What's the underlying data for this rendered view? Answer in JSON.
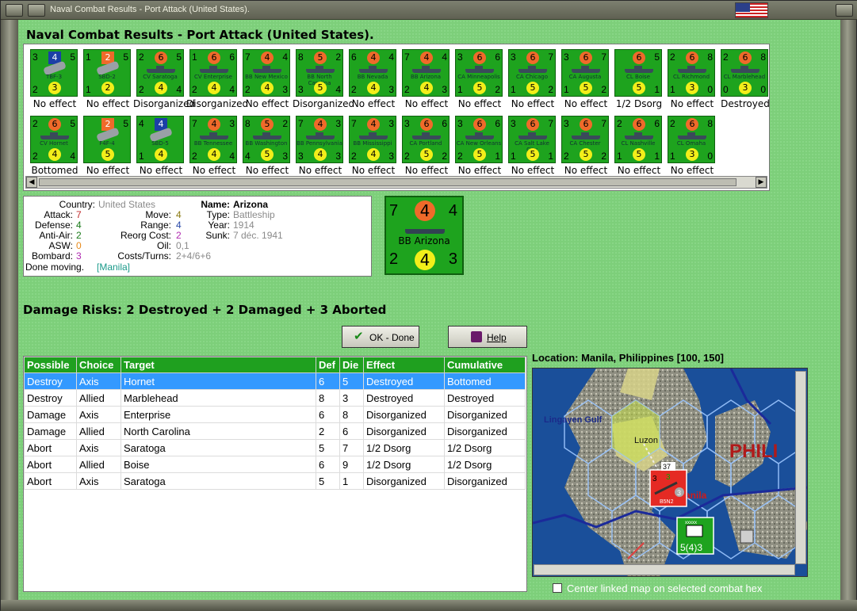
{
  "window": {
    "title": "Naval Combat Results - Port Attack (United States)."
  },
  "heading": "Naval Combat Results - Port Attack (United States).",
  "colors": {
    "felt": "#7dcf7a",
    "counter": "#1ea31e",
    "attack_circle": "#ef6a2a",
    "defense_circle": "#f2ee1a",
    "header": "#1fa01f",
    "selection": "#3399ff"
  },
  "units": [
    {
      "tl": "3",
      "top": "4",
      "top_style": "sq",
      "tr": "5",
      "bl": "2",
      "bot": "3",
      "br": "",
      "name": "TBF-3",
      "kind": "plane",
      "effect": "No effect"
    },
    {
      "tl": "1",
      "top": "2",
      "top_style": "sqo",
      "tr": "5",
      "bl": "1",
      "bot": "2",
      "br": "",
      "name": "SBD-2",
      "kind": "plane",
      "effect": "No effect"
    },
    {
      "tl": "2",
      "top": "6",
      "top_style": "",
      "tr": "5",
      "bl": "2",
      "bot": "4",
      "br": "4",
      "name": "CV Saratoga",
      "kind": "ship",
      "effect": "Disorganized"
    },
    {
      "tl": "1",
      "top": "6",
      "top_style": "",
      "tr": "6",
      "bl": "2",
      "bot": "4",
      "br": "4",
      "name": "CV Enterprise",
      "kind": "ship",
      "effect": "Disorganized"
    },
    {
      "tl": "7",
      "top": "4",
      "top_style": "",
      "tr": "4",
      "bl": "2",
      "bot": "4",
      "br": "3",
      "name": "BB New Mexico",
      "kind": "ship",
      "effect": "No effect"
    },
    {
      "tl": "8",
      "top": "5",
      "top_style": "",
      "tr": "2",
      "bl": "3",
      "bot": "5",
      "br": "4",
      "name": "BB North Carolina",
      "kind": "ship",
      "effect": "Disorganized"
    },
    {
      "tl": "6",
      "top": "4",
      "top_style": "",
      "tr": "4",
      "bl": "2",
      "bot": "4",
      "br": "3",
      "name": "BB Nevada",
      "kind": "ship",
      "effect": "No effect"
    },
    {
      "tl": "7",
      "top": "4",
      "top_style": "",
      "tr": "4",
      "bl": "2",
      "bot": "4",
      "br": "3",
      "name": "BB Arizona",
      "kind": "ship",
      "effect": "No effect"
    },
    {
      "tl": "3",
      "top": "6",
      "top_style": "",
      "tr": "6",
      "bl": "1",
      "bot": "5",
      "br": "2",
      "name": "CA Minneapolis",
      "kind": "ship",
      "effect": "No effect"
    },
    {
      "tl": "3",
      "top": "6",
      "top_style": "",
      "tr": "7",
      "bl": "1",
      "bot": "5",
      "br": "2",
      "name": "CA Chicago",
      "kind": "ship",
      "effect": "No effect"
    },
    {
      "tl": "3",
      "top": "6",
      "top_style": "",
      "tr": "7",
      "bl": "1",
      "bot": "5",
      "br": "2",
      "name": "CA Augusta",
      "kind": "ship",
      "effect": "No effect"
    },
    {
      "tl": "",
      "top": "6",
      "top_style": "",
      "tr": "5",
      "bl": "",
      "bot": "5",
      "br": "1",
      "name": "CL Boise",
      "kind": "ship",
      "effect": "1/2 Dsorg"
    },
    {
      "tl": "2",
      "top": "6",
      "top_style": "",
      "tr": "8",
      "bl": "1",
      "bot": "3",
      "br": "0",
      "name": "CL Richmond",
      "kind": "ship",
      "effect": "No effect"
    },
    {
      "tl": "2",
      "top": "6",
      "top_style": "",
      "tr": "8",
      "bl": "0",
      "bot": "3",
      "br": "0",
      "name": "CL Marblehead",
      "kind": "ship",
      "effect": "Destroyed"
    },
    {
      "tl": "2",
      "top": "6",
      "top_style": "",
      "tr": "5",
      "bl": "2",
      "bot": "4",
      "br": "4",
      "name": "CV Hornet",
      "kind": "ship",
      "effect": "Bottomed"
    },
    {
      "tl": "",
      "top": "2",
      "top_style": "sqo",
      "tr": "5",
      "bl": "",
      "bot": "5",
      "br": "",
      "name": "F4F-4",
      "kind": "plane",
      "effect": "No effect"
    },
    {
      "tl": "4",
      "top": "4",
      "top_style": "sq",
      "tr": "",
      "bl": "1",
      "bot": "4",
      "br": "",
      "name": "SBD-5",
      "kind": "plane",
      "effect": "No effect"
    },
    {
      "tl": "7",
      "top": "4",
      "top_style": "",
      "tr": "3",
      "bl": "2",
      "bot": "4",
      "br": "4",
      "name": "BB Tennessee",
      "kind": "ship",
      "effect": "No effect"
    },
    {
      "tl": "8",
      "top": "5",
      "top_style": "",
      "tr": "2",
      "bl": "4",
      "bot": "5",
      "br": "3",
      "name": "BB Washington",
      "kind": "ship",
      "effect": "No effect"
    },
    {
      "tl": "7",
      "top": "4",
      "top_style": "",
      "tr": "3",
      "bl": "3",
      "bot": "4",
      "br": "3",
      "name": "BB Pennsylvania",
      "kind": "ship",
      "effect": "No effect"
    },
    {
      "tl": "7",
      "top": "4",
      "top_style": "",
      "tr": "3",
      "bl": "2",
      "bot": "4",
      "br": "3",
      "name": "BB Mississippi",
      "kind": "ship",
      "effect": "No effect"
    },
    {
      "tl": "3",
      "top": "6",
      "top_style": "",
      "tr": "6",
      "bl": "2",
      "bot": "5",
      "br": "2",
      "name": "CA Portland",
      "kind": "ship",
      "effect": "No effect"
    },
    {
      "tl": "3",
      "top": "6",
      "top_style": "",
      "tr": "6",
      "bl": "2",
      "bot": "5",
      "br": "1",
      "name": "CA New Orleans",
      "kind": "ship",
      "effect": "No effect"
    },
    {
      "tl": "3",
      "top": "6",
      "top_style": "",
      "tr": "7",
      "bl": "1",
      "bot": "5",
      "br": "1",
      "name": "CA Salt Lake City",
      "kind": "ship",
      "effect": "No effect"
    },
    {
      "tl": "3",
      "top": "6",
      "top_style": "",
      "tr": "7",
      "bl": "2",
      "bot": "5",
      "br": "2",
      "name": "CA Chester",
      "kind": "ship",
      "effect": "No effect"
    },
    {
      "tl": "2",
      "top": "6",
      "top_style": "",
      "tr": "6",
      "bl": "1",
      "bot": "5",
      "br": "1",
      "name": "CL Nashville",
      "kind": "ship",
      "effect": "No effect"
    },
    {
      "tl": "2",
      "top": "6",
      "top_style": "",
      "tr": "8",
      "bl": "1",
      "bot": "3",
      "br": "0",
      "name": "CL Omaha",
      "kind": "ship",
      "effect": "No effect"
    }
  ],
  "info": {
    "country_label": "Country:",
    "country": "United States",
    "attack_label": "Attack:",
    "attack": "7",
    "defense_label": "Defense:",
    "defense": "4",
    "antiair_label": "Anti-Air:",
    "antiair": "2",
    "asw_label": "ASW:",
    "asw": "0",
    "bombard_label": "Bombard:",
    "bombard": "3",
    "move_label": "Move:",
    "move": "4",
    "range_label": "Range:",
    "range": "4",
    "reorg_label": "Reorg Cost:",
    "reorg": "2",
    "oil_label": "Oil:",
    "oil": "0,1",
    "costs_label": "Costs/Turns:",
    "costs": "2+4/6+6",
    "name_label": "Name:",
    "name": "Arizona",
    "type_label": "Type:",
    "type": "Battleship",
    "year_label": "Year:",
    "year": "1914",
    "sunk_label": "Sunk:",
    "sunk": "7 déc. 1941",
    "status_text": "Done moving.",
    "status_link": "[Manila]"
  },
  "big_counter": {
    "tl": "7",
    "top": "4",
    "tr": "4",
    "name": "BB Arizona",
    "bl": "2",
    "bot": "4",
    "br": "3"
  },
  "risks": "Damage Risks:  2 Destroyed + 2 Damaged + 3 Aborted",
  "buttons": {
    "ok": "OK - Done",
    "help": "Help"
  },
  "table": {
    "headers": [
      "Possible",
      "Choice",
      "Target",
      "Def",
      "Die",
      "Effect",
      "Cumulative"
    ],
    "rows": [
      [
        "Destroy",
        "Axis",
        "Hornet",
        "6",
        "5",
        "Destroyed",
        "Bottomed"
      ],
      [
        "Destroy",
        "Allied",
        "Marblehead",
        "8",
        "3",
        "Destroyed",
        "Destroyed"
      ],
      [
        "Damage",
        "Axis",
        "Enterprise",
        "6",
        "8",
        "Disorganized",
        "Disorganized"
      ],
      [
        "Damage",
        "Allied",
        "North Carolina",
        "2",
        "6",
        "Disorganized",
        "Disorganized"
      ],
      [
        "Abort",
        "Axis",
        "Saratoga",
        "5",
        "7",
        "1/2 Dsorg",
        "1/2 Dsorg"
      ],
      [
        "Abort",
        "Allied",
        "Boise",
        "6",
        "9",
        "1/2 Dsorg",
        "1/2 Dsorg"
      ],
      [
        "Abort",
        "Axis",
        "Saratoga",
        "5",
        "1",
        "Disorganized",
        "Disorganized"
      ]
    ],
    "selected_row": 0
  },
  "map": {
    "location_label": "Location:  Manila, Philippines [100, 150]",
    "labels": {
      "gulf": "Lingayen Gulf",
      "island": "Luzon",
      "country": "PHILI",
      "city": "Manila"
    },
    "enemy_unit": {
      "top_left": "3",
      "top_mid": "3",
      "badge": "3",
      "name": "B5N2",
      "stack": "37"
    },
    "hq_unit": {
      "label": "xxxxx",
      "values": "5(4)3"
    }
  },
  "center_checkbox": {
    "label": "Center linked map on selected combat hex",
    "checked": false
  }
}
